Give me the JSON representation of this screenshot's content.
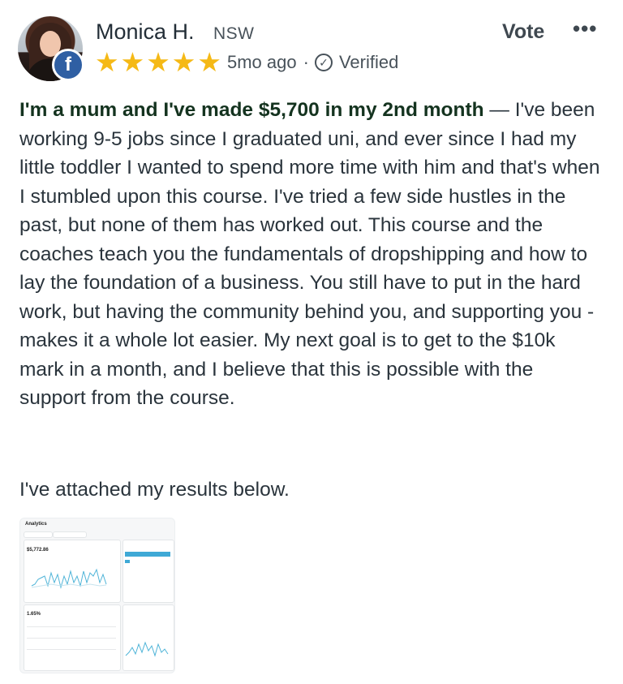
{
  "reviewer": {
    "name": "Monica H.",
    "state": "NSW",
    "badge_letter": "f",
    "stars": [
      "★",
      "★",
      "★",
      "★",
      "★"
    ],
    "time": "5mo ago",
    "separator": "·",
    "verified_label": "Verified"
  },
  "actions": {
    "vote_label": "Vote",
    "more_label": "•••"
  },
  "review": {
    "headline": "I'm a mum and I've made $5,700 in my 2nd month",
    "body": " — I've been working 9-5 jobs since I graduated uni, and ever since I had my little toddler I wanted to spend more time with him and that's when I stumbled upon this course. I've tried a few side hustles in the past, but none of them has worked out. This course and the coaches teach you the fundamentals of dropshipping and how to lay the foundation of a business. You still have to put in the hard work, but having the community behind you, and supporting you - makes it a whole lot easier. My next goal is to get to the $10k mark in a month, and I believe that this is possible with the support from the course.",
    "attachment_note": "I've attached my results below."
  },
  "attachment": {
    "title": "Analytics",
    "total_sales_value": "$5,772.86",
    "conversion_value": "1.65%"
  },
  "colors": {
    "star": "#f5b916",
    "facebook": "#2f5fa3",
    "headline": "#14331f"
  }
}
